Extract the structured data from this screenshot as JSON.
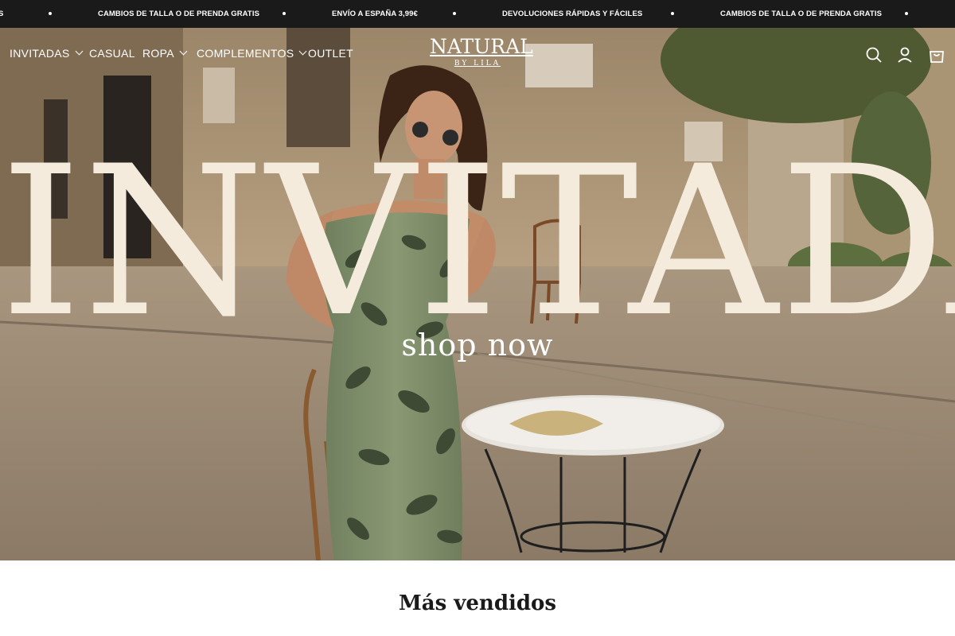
{
  "announcement_bar": {
    "messages": [
      "S",
      "CAMBIOS DE TALLA O DE PRENDA GRATIS",
      "ENVÍO A ESPAÑA 3,99€",
      "DEVOLUCIONES RÁPIDAS Y FÁCILES",
      "CAMBIOS DE TALLA O DE PRENDA GRATIS"
    ]
  },
  "nav": {
    "items": [
      {
        "label": "INVITADAS",
        "has_dropdown": true
      },
      {
        "label": "CASUAL",
        "has_dropdown": false
      },
      {
        "label": "ROPA",
        "has_dropdown": true
      },
      {
        "label": "COMPLEMENTOS",
        "has_dropdown": true
      },
      {
        "label": "OUTLET",
        "has_dropdown": false
      }
    ],
    "icons": [
      "search-icon",
      "account-icon",
      "cart-icon"
    ]
  },
  "logo": {
    "main": "NATURAL",
    "sub": "BY LILA"
  },
  "hero": {
    "title": "INVITADA",
    "cta": "shop now",
    "title_color": "#f4ebdc"
  },
  "section": {
    "title": "Más vendidos"
  }
}
